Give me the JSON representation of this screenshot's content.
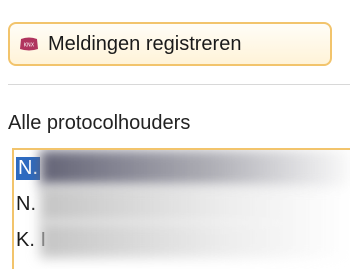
{
  "toolbar": {
    "register_button_label": "Meldingen registreren",
    "register_icon": "knx-device-icon"
  },
  "list": {
    "header": "Alle protocolhouders",
    "items": [
      {
        "label": "N.",
        "selected": true
      },
      {
        "label": "N.",
        "selected": false
      },
      {
        "label": "K. I",
        "selected": false
      }
    ]
  },
  "colors": {
    "focus_border": "#f2c46c",
    "selection": "#2e6bc0",
    "icon_fill": "#b0345e"
  }
}
